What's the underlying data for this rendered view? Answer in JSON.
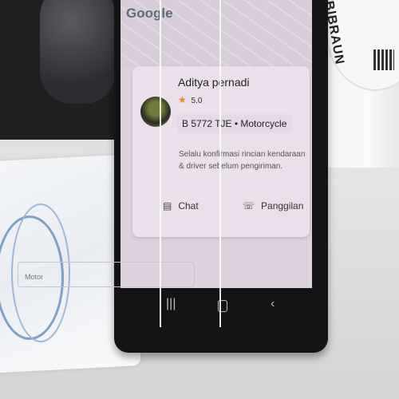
{
  "screen": {
    "brand": "Google",
    "driver": {
      "name": "Aditya pernadi",
      "rating": "5.0",
      "plate_vehicle": "B 5772 TJE • Motorcycle"
    },
    "notice": "Selalu konfirmasi rincian kendaraan & driver sebelum pengiriman.",
    "actions": {
      "chat": "Chat",
      "call": "Panggilan"
    },
    "field_label": "Motor"
  },
  "background": {
    "box_label": "B|BRAUN"
  },
  "colors": {
    "screen_tint": "#ddd1de",
    "card": "#eadfeb",
    "star": "#e98a1e",
    "phone_body": "#141416"
  },
  "icons": [
    "star-icon",
    "chat-icon",
    "phone-icon",
    "nav-recent-icon",
    "nav-home-icon",
    "nav-back-icon"
  ]
}
